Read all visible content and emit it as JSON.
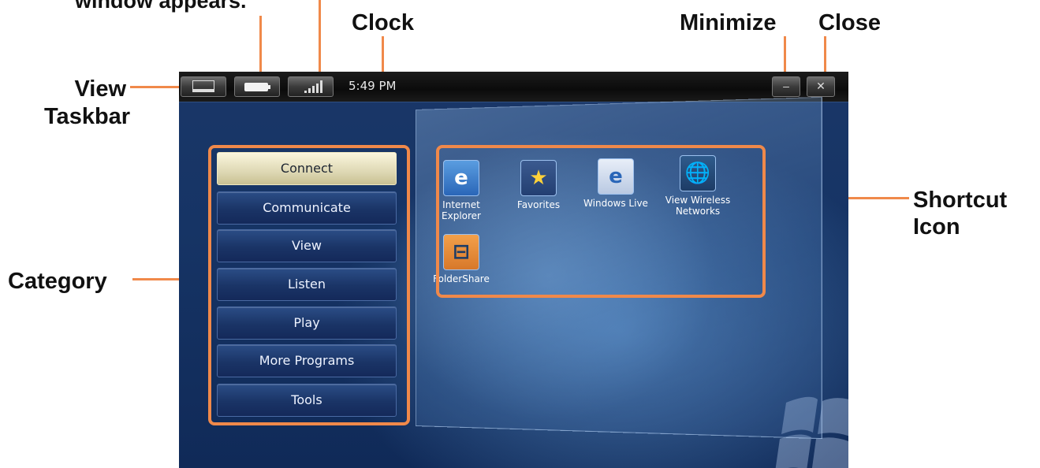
{
  "callouts": {
    "window_appears": "window appears.",
    "clock": "Clock",
    "minimize": "Minimize",
    "close": "Close",
    "view_taskbar_line1": "View",
    "view_taskbar_line2": "Taskbar",
    "category": "Category",
    "shortcut_icon_line1": "Shortcut",
    "shortcut_icon_line2": "Icon"
  },
  "topbar": {
    "clock_text": "5:49 PM",
    "buttons": [
      "view-taskbar",
      "battery",
      "signal"
    ],
    "minimize_symbol": "–",
    "close_symbol": "✕"
  },
  "categories": [
    {
      "label": "Connect",
      "active": true
    },
    {
      "label": "Communicate",
      "active": false
    },
    {
      "label": "View",
      "active": false
    },
    {
      "label": "Listen",
      "active": false
    },
    {
      "label": "Play",
      "active": false
    },
    {
      "label": "More Programs",
      "active": false
    },
    {
      "label": "Tools",
      "active": false
    }
  ],
  "shortcuts": [
    {
      "label": "Internet Explorer",
      "icon": "internet-explorer-icon"
    },
    {
      "label": "Favorites",
      "icon": "star-icon"
    },
    {
      "label": "Windows Live",
      "icon": "windows-live-icon"
    },
    {
      "label": "View Wireless Networks",
      "icon": "wireless-globe-icon"
    },
    {
      "label": "FolderShare",
      "icon": "foldershare-icon"
    }
  ],
  "colors": {
    "callout_accent": "#f0894a",
    "desktop_blue": "#163465",
    "active_category": "#f5f0d2"
  }
}
